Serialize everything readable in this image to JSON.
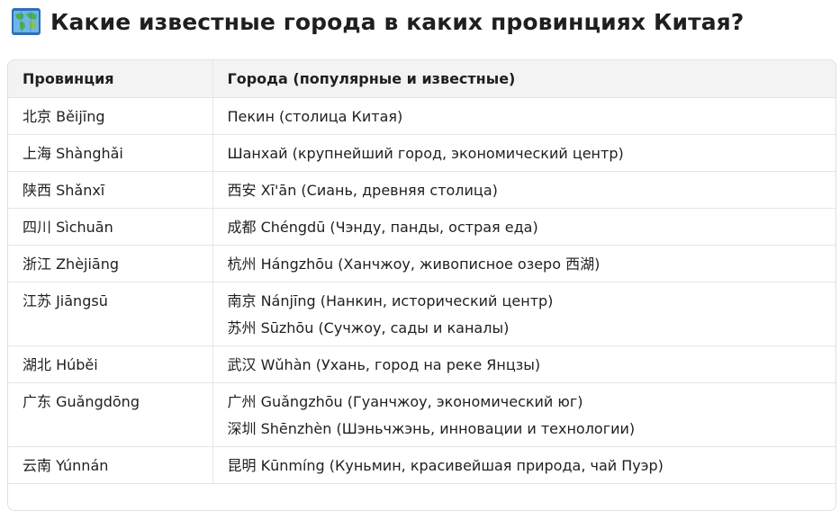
{
  "page": {
    "title": "Какие известные города в каких провинциях Китая?",
    "icon": "world-map-icon"
  },
  "table": {
    "headers": [
      "Провинция",
      "Города (популярные и известные)"
    ],
    "rows": [
      {
        "province": "北京 Běijīng",
        "cities": [
          "Пекин (столица Китая)"
        ]
      },
      {
        "province": "上海 Shànghǎi",
        "cities": [
          "Шанхай (крупнейший город, экономический центр)"
        ]
      },
      {
        "province": "陕西 Shǎnxī",
        "cities": [
          "西安 Xī'ān (Сиань, древняя столица)"
        ]
      },
      {
        "province": "四川 Sìchuān",
        "cities": [
          "成都 Chéngdū (Чэнду, панды, острая еда)"
        ]
      },
      {
        "province": "浙江 Zhèjiāng",
        "cities": [
          "杭州 Hángzhōu (Ханчжоу, живописное озеро 西湖)"
        ]
      },
      {
        "province": "江苏 Jiāngsū",
        "cities": [
          "南京 Nánjīng (Нанкин, исторический центр)",
          "苏州 Sūzhōu (Сучжоу, сады и каналы)"
        ]
      },
      {
        "province": "湖北 Húběi",
        "cities": [
          "武汉 Wǔhàn (Ухань, город на реке Янцзы)"
        ]
      },
      {
        "province": "广东 Guǎngdōng",
        "cities": [
          "广州 Guǎngzhōu (Гуанчжоу, экономический юг)",
          "深圳 Shēnzhèn (Шэньчжэнь, инновации и технологии)"
        ]
      },
      {
        "province": "云南 Yúnnán",
        "cities": [
          "昆明 Kūnmíng (Куньмин, красивейшая природа, чай Пуэр)"
        ]
      }
    ]
  }
}
